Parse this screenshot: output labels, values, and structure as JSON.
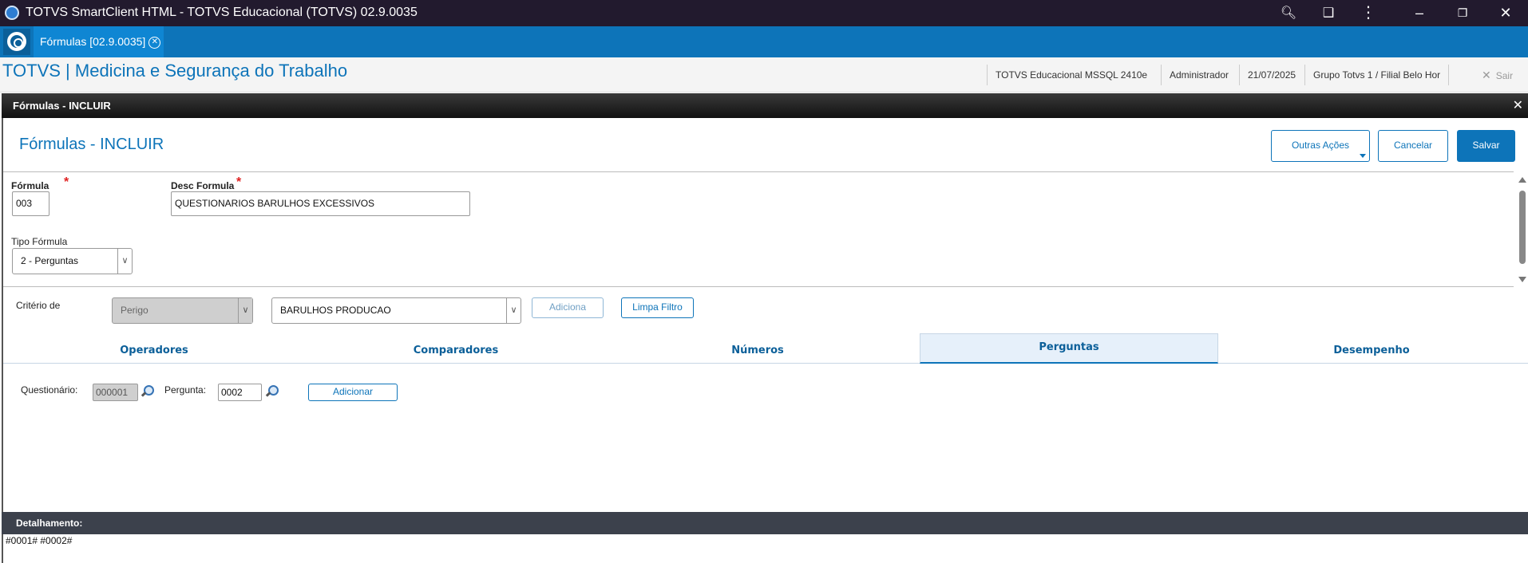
{
  "window": {
    "title": "TOTVS SmartClient HTML - TOTVS Educacional (TOTVS) 02.9.0035",
    "zoom_icon": "zoom-icon",
    "extension_icon": "extension-icon",
    "menu_icon": "kebab-menu-icon"
  },
  "tabstrip": {
    "tab_label": "Fórmulas [02.9.0035]"
  },
  "header": {
    "brand": "TOTVS | Medicina e Segurança do Trabalho",
    "environment": "TOTVS Educacional MSSQL 2410e",
    "user": "Administrador",
    "date": "21/07/2025",
    "branch": "Grupo Totvs 1 / Filial Belo Hor",
    "logout_label": "Sair"
  },
  "dialog": {
    "title": "Fórmulas - INCLUIR",
    "page_title": "Fórmulas - INCLUIR",
    "actions": {
      "other": "Outras Ações",
      "cancel": "Cancelar",
      "save": "Salvar"
    }
  },
  "form": {
    "formula_label": "Fórmula",
    "formula_value": "003",
    "desc_label": "Desc Formula",
    "desc_value": "QUESTIONARIOS BARULHOS EXCESSIVOS",
    "tipo_label": "Tipo Fórmula",
    "tipo_value": "2 - Perguntas",
    "required_mark": "*"
  },
  "criteria": {
    "label": "Critério de",
    "type_value": "Perigo",
    "item_value": "BARULHOS PRODUCAO",
    "add_label": "Adiciona",
    "clear_label": "Limpa Filtro"
  },
  "tabs": [
    {
      "label": "Operadores"
    },
    {
      "label": "Comparadores"
    },
    {
      "label": "Números"
    },
    {
      "label": "Perguntas"
    },
    {
      "label": "Desempenho"
    }
  ],
  "perguntas": {
    "questionario_label": "Questionário:",
    "questionario_value": "000001",
    "pergunta_label": "Pergunta:",
    "pergunta_value": "0002",
    "add_label": "Adicionar"
  },
  "detalhamento": {
    "label": "Detalhamento:",
    "value": "#0001# #0002#"
  }
}
